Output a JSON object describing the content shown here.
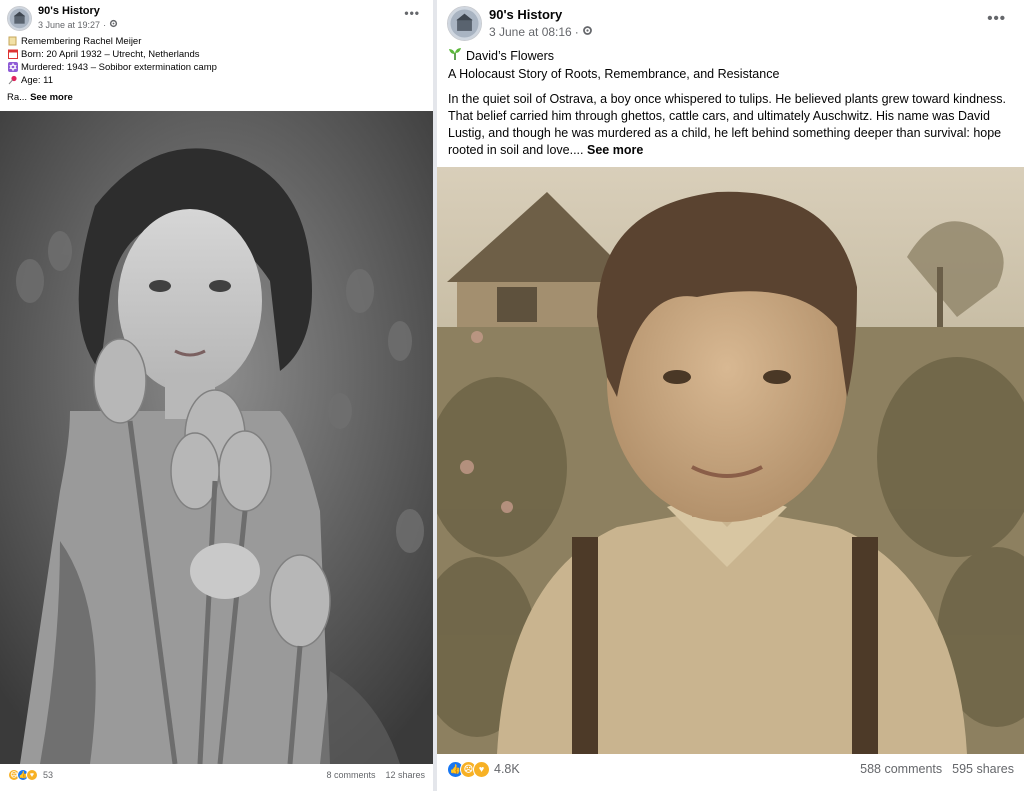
{
  "left_post": {
    "page_name": "90's History",
    "timestamp": "3 June at 19:27",
    "lines": [
      {
        "icon": "book-icon",
        "text": "Remembering Rachel Meijer"
      },
      {
        "icon": "calendar-icon",
        "text": "Born: 20 April 1932 – Utrecht, Netherlands"
      },
      {
        "icon": "star-of-david-icon",
        "text": "Murdered: 1943 – Sobibor extermination camp"
      },
      {
        "icon": "pushpin-icon",
        "text": "Age: 11"
      }
    ],
    "truncated_text": "Ra...",
    "see_more": "See more",
    "reaction_count": "53",
    "comments": "8 comments",
    "shares": "12 shares"
  },
  "right_post": {
    "page_name": "90's History",
    "timestamp": "3 June at 08:16",
    "title_icon": "seedling-icon",
    "title": "David’s Flowers",
    "subtitle": "A Holocaust Story of Roots, Remembrance, and Resistance",
    "paragraph": "In the quiet soil of Ostrava, a boy once whispered to tulips. He believed plants grew toward kindness. That belief carried him through ghettos, cattle cars, and ultimately Auschwitz. His name was David Lustig, and though he was murdered as a child, he left behind something deeper than survival: hope rooted in soil and love.... ",
    "see_more": "See more",
    "reaction_count": "4.8K",
    "comments": "588 comments",
    "shares": "595 shares"
  },
  "colors": {
    "page_bg": "#e4e6eb",
    "card_bg": "#ffffff",
    "meta_text": "#65676b",
    "like_blue": "#1877f2",
    "emoji_yellow": "#f7b125"
  }
}
